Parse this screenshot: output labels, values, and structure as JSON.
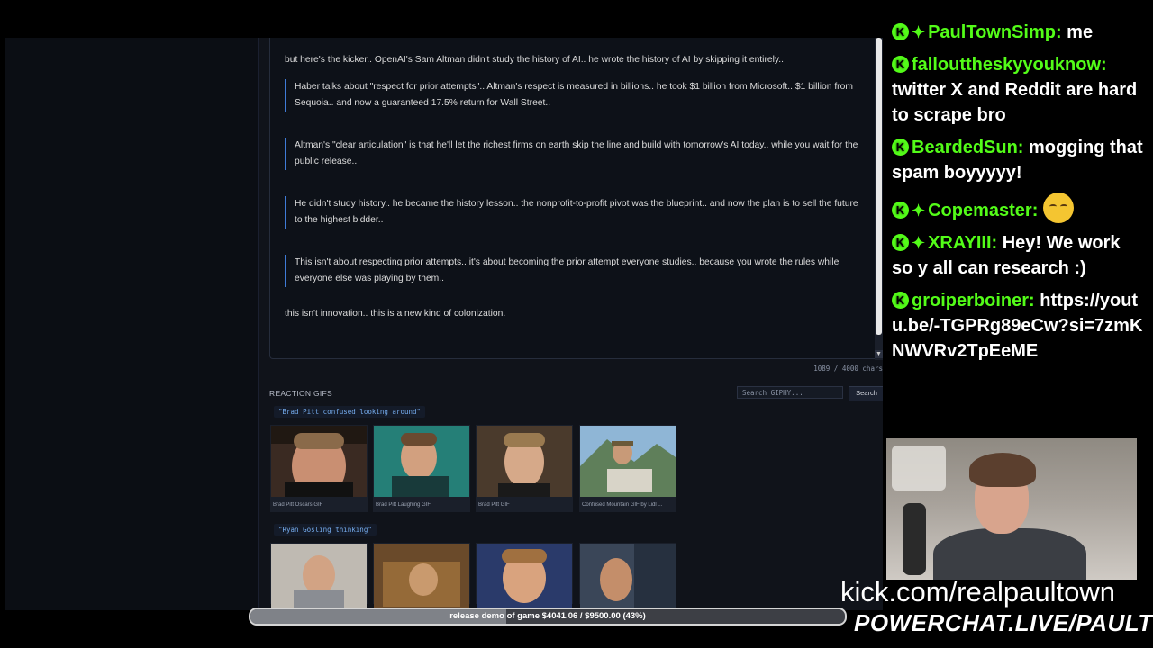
{
  "post": {
    "lead": "but here's the kicker.. OpenAI's Sam Altman didn't study the history of AI.. he wrote the history of AI by skipping it entirely..",
    "quotes": [
      "Haber talks about \"respect for prior attempts\".. Altman's respect is measured in billions.. he took $1 billion from Microsoft.. $1 billion from Sequoia.. and now a guaranteed 17.5% return for Wall Street..",
      "Altman's \"clear articulation\" is that he'll let the richest firms on earth skip the line and build with tomorrow's AI today.. while you wait for the public release..",
      "He didn't study history.. he became the history lesson.. the nonprofit-to-profit pivot was the blueprint.. and now the plan is to sell the future to the highest bidder..",
      "This isn't about respecting prior attempts.. it's about becoming the prior attempt everyone studies.. because you wrote the rules while everyone else was playing by them.."
    ],
    "tail": "this isn't innovation.. this is a new kind of colonization.",
    "char_count": "1089 / 4000 chars"
  },
  "reaction_gifs": {
    "label": "REACTION GIFS",
    "search_placeholder": "Search GIPHY...",
    "search_button": "Search",
    "groups": [
      {
        "query": "\"Brad Pitt confused looking around\"",
        "gifs": [
          {
            "caption": "Brad Pitt Oscars GIF"
          },
          {
            "caption": "Brad Pitt Laughing GIF"
          },
          {
            "caption": "Brad Pitt GIF"
          },
          {
            "caption": "Confused Mountain GIF by Lidl ..."
          }
        ]
      },
      {
        "query": "\"Ryan Gosling thinking\"",
        "gifs": [
          {
            "caption": ""
          },
          {
            "caption": ""
          },
          {
            "caption": ""
          },
          {
            "caption": ""
          }
        ]
      }
    ]
  },
  "chat": {
    "messages": [
      {
        "user": "PaulTownSimp:",
        "text": " me",
        "badges": [
          "kick",
          "diamond"
        ]
      },
      {
        "user": "fallouttheskyyouknow:",
        "text": " twitter X and Reddit are hard to scrape bro",
        "badges": [
          "kick"
        ]
      },
      {
        "user": "BeardedSun:",
        "text": " mogging that spam boyyyyy!",
        "badges": [
          "kick"
        ]
      },
      {
        "user": "Copemaster:",
        "text": " ",
        "badges": [
          "kick",
          "diamond"
        ],
        "emote": "relieved-face-emoji"
      },
      {
        "user": "XRAYIII:",
        "text": " Hey! We work so y all can research :)",
        "badges": [
          "kick",
          "diamond"
        ]
      },
      {
        "user": "groiperboiner:",
        "text": " https://youtu.be/-TGPRg89eCw?si=7zmKNWVRv2TpEeME",
        "badges": [
          "kick"
        ]
      }
    ]
  },
  "overlay": {
    "kick_url": "kick.com/realpaultown",
    "powerchat": "POWERCHAT.LIVE/PAULTOWN",
    "donation_text": "release demo of game $4041.06 / $9500.00 (43%)",
    "donation_progress": 0.43
  },
  "colors": {
    "kick_green": "#53fc18",
    "quote_border": "#3f7bd6",
    "query_text": "#77aef0"
  }
}
